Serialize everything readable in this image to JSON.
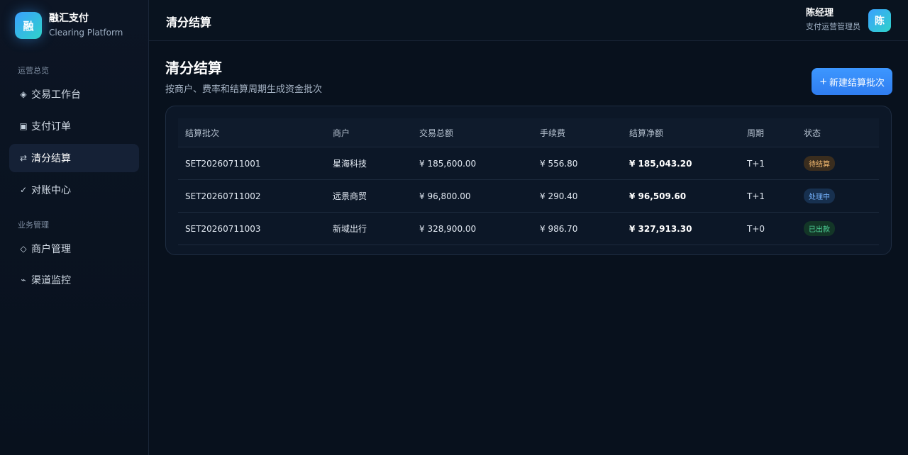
{
  "brand": {
    "name": "融汇支付",
    "subtitle": "Clearing Platform",
    "logo_char": "融"
  },
  "sidebar": {
    "groups": [
      {
        "title": "运营总览"
      },
      {
        "title": "业务管理"
      }
    ],
    "items": [
      {
        "icon": "◈",
        "icon_name": "diamond-dot-icon",
        "label": "交易工作台"
      },
      {
        "icon": "▣",
        "icon_name": "square-icon",
        "label": "支付订单"
      },
      {
        "icon": "⇄",
        "icon_name": "swap-icon",
        "label": "清分结算",
        "active": true
      },
      {
        "icon": "✓",
        "icon_name": "check-icon",
        "label": "对账中心"
      },
      {
        "icon": "◇",
        "icon_name": "diamond-icon",
        "label": "商户管理"
      },
      {
        "icon": "⌁",
        "icon_name": "signal-icon",
        "label": "渠道监控"
      }
    ]
  },
  "topbar": {
    "title": "清分结算",
    "user": {
      "name": "陈经理",
      "role": "支付运营管理员",
      "avatar_char": "陈"
    }
  },
  "page": {
    "title": "清分结算",
    "description": "按商户、费率和结算周期生成资金批次",
    "new_button": {
      "icon": "+",
      "label": "新建结算批次"
    }
  },
  "table": {
    "headers": [
      "结算批次",
      "商户",
      "交易总额",
      "手续费",
      "结算净额",
      "周期",
      "状态"
    ],
    "rows": [
      {
        "batch": "SET20260711001",
        "merchant": "星海科技",
        "total": "¥ 185,600.00",
        "fee": "¥ 556.80",
        "net": "¥ 185,043.20",
        "cycle": "T+1",
        "status": "待结算",
        "status_type": "pending"
      },
      {
        "batch": "SET20260711002",
        "merchant": "远景商贸",
        "total": "¥ 96,800.00",
        "fee": "¥ 290.40",
        "net": "¥ 96,509.60",
        "cycle": "T+1",
        "status": "处理中",
        "status_type": "processing"
      },
      {
        "batch": "SET20260711003",
        "merchant": "新域出行",
        "total": "¥ 328,900.00",
        "fee": "¥ 986.70",
        "net": "¥ 327,913.30",
        "cycle": "T+0",
        "status": "已出款",
        "status_type": "paid"
      }
    ]
  },
  "colors": {
    "accent": "#3d97ff",
    "pending": "#f2b970",
    "processing": "#76b4ff",
    "paid": "#4fd69a"
  }
}
